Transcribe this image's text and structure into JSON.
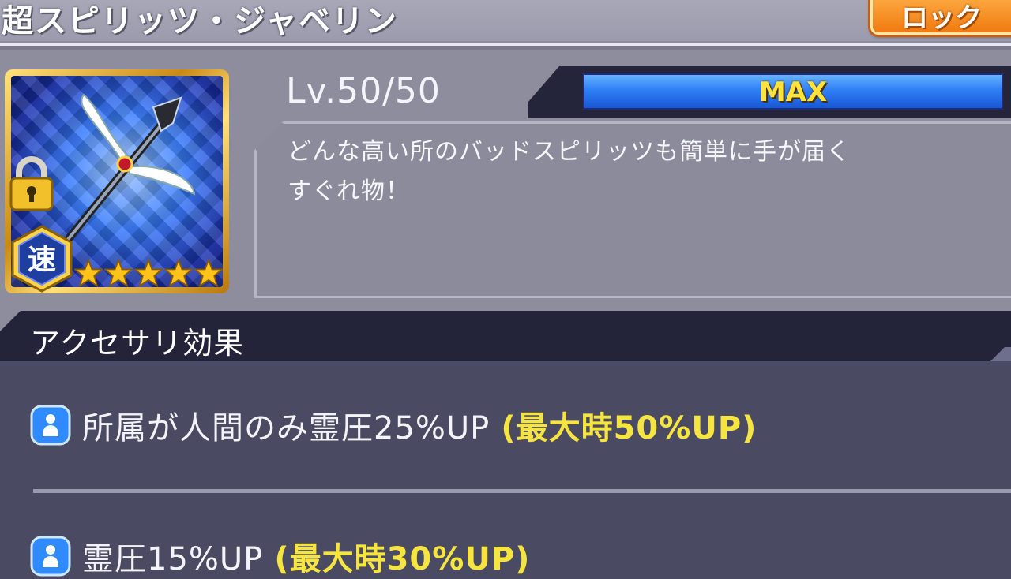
{
  "item": {
    "name": "超スピリッツ・ジャベリン",
    "lock_button": "ロック",
    "level": "Lv.50/50",
    "bar_label": "MAX",
    "bar_progress": 1.0,
    "speed_badge": "速",
    "star_count": 5,
    "description_line1": "どんな高い所のバッドスピリッツも簡単に手が届く",
    "description_line2": "すぐれ物！"
  },
  "effects": {
    "title": "アクセサリ効果",
    "rows": [
      {
        "text": "所属が人間のみ霊圧25%UP",
        "max": "(最大時50%UP)",
        "icon": "person-icon"
      },
      {
        "text": "霊圧15%UP",
        "max": "(最大時30%UP)",
        "icon": "person-icon"
      }
    ]
  },
  "colors": {
    "max_yellow": "#ffe23a",
    "effect_max_yellow": "#f6e540",
    "bar_blue": "#2f7ff5",
    "lock_orange": "#f07a10"
  }
}
